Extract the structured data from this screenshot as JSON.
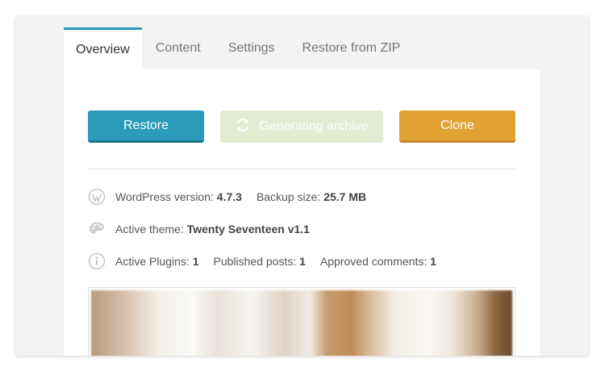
{
  "tabs": [
    {
      "label": "Overview",
      "active": true
    },
    {
      "label": "Content",
      "active": false
    },
    {
      "label": "Settings",
      "active": false
    },
    {
      "label": "Restore from ZIP",
      "active": false
    }
  ],
  "actions": {
    "restore_label": "Restore",
    "generating_label": "Generating archive",
    "clone_label": "Clone"
  },
  "info": {
    "wp_version_label": "WordPress version:",
    "wp_version_value": "4.7.3",
    "backup_size_label": "Backup size:",
    "backup_size_value": "25.7 MB",
    "active_theme_label": "Active theme:",
    "active_theme_value": "Twenty Seventeen v1.1",
    "active_plugins_label": "Active Plugins:",
    "active_plugins_value": "1",
    "published_posts_label": "Published posts:",
    "published_posts_value": "1",
    "approved_comments_label": "Approved comments:",
    "approved_comments_value": "1"
  },
  "icons": {
    "wordpress": "wordpress-icon",
    "palette": "palette-icon",
    "info": "info-icon",
    "spinner": "refresh-icon"
  },
  "colors": {
    "accent": "#2a9bbf",
    "restore": "#2a9bb8",
    "generating": "#e1ecd0",
    "clone": "#e0a333"
  }
}
